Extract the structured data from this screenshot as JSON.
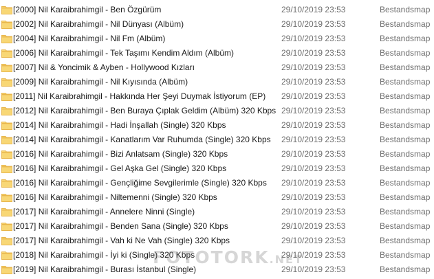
{
  "folders": [
    {
      "name": "[2000] Nil Karaibrahimgil - Ben Özgürüm",
      "date": "29/10/2019 23:53",
      "type": "Bestandsmap"
    },
    {
      "name": "[2002] Nil Karaibrahimgil - Nil Dünyası (Albüm)",
      "date": "29/10/2019 23:53",
      "type": "Bestandsmap"
    },
    {
      "name": "[2004] Nil Karaibrahimgil - Nil Fm (Albüm)",
      "date": "29/10/2019 23:53",
      "type": "Bestandsmap"
    },
    {
      "name": "[2006] Nil Karaibrahimgil - Tek Taşımı Kendim Aldım (Albüm)",
      "date": "29/10/2019 23:53",
      "type": "Bestandsmap"
    },
    {
      "name": "[2007] Nil & Yoncimik & Ayben - Hollywood Kızları",
      "date": "29/10/2019 23:53",
      "type": "Bestandsmap"
    },
    {
      "name": "[2009] Nil Karaibrahimgil - Nil Kıyısında (Albüm)",
      "date": "29/10/2019 23:53",
      "type": "Bestandsmap"
    },
    {
      "name": "[2011] Nil Karaibrahimgil - Hakkında Her Şeyi Duymak İstiyorum (EP)",
      "date": "29/10/2019 23:53",
      "type": "Bestandsmap"
    },
    {
      "name": "[2012] Nil Karaibrahimgil - Ben Buraya Çıplak Geldim (Albüm) 320 Kbps",
      "date": "29/10/2019 23:53",
      "type": "Bestandsmap"
    },
    {
      "name": "[2014] Nil Karaibrahimgil - Hadi İnşallah (Single) 320 Kbps",
      "date": "29/10/2019 23:53",
      "type": "Bestandsmap"
    },
    {
      "name": "[2014] Nil Karaibrahimgil - Kanatlarım Var Ruhumda (Single) 320 Kbps",
      "date": "29/10/2019 23:53",
      "type": "Bestandsmap"
    },
    {
      "name": "[2016] Nil Karaibrahimgil - Bizi Anlatsam (Single) 320 Kbps",
      "date": "29/10/2019 23:53",
      "type": "Bestandsmap"
    },
    {
      "name": "[2016] Nil Karaibrahimgil - Gel Aşka Gel (Single) 320 Kbps",
      "date": "29/10/2019 23:53",
      "type": "Bestandsmap"
    },
    {
      "name": "[2016] Nil Karaibrahimgil - Gençliğime Sevgilerimle (Single) 320 Kbps",
      "date": "29/10/2019 23:53",
      "type": "Bestandsmap"
    },
    {
      "name": "[2016] Nil Karaibrahimgil - Niltemenni (Single) 320 Kbps",
      "date": "29/10/2019 23:53",
      "type": "Bestandsmap"
    },
    {
      "name": "[2017] Nil Karaibrahimgil - Annelere Ninni (Single)",
      "date": "29/10/2019 23:53",
      "type": "Bestandsmap"
    },
    {
      "name": "[2017] Nil Karaibrahimgil - Benden Sana (Single) 320 Kbps",
      "date": "29/10/2019 23:53",
      "type": "Bestandsmap"
    },
    {
      "name": "[2017] Nil Karaibrahimgil - Vah ki Ne Vah (Single) 320 Kbps",
      "date": "29/10/2019 23:53",
      "type": "Bestandsmap"
    },
    {
      "name": "[2018] Nil Karaibrahimgil - İyi ki (Single) 320 Kbps",
      "date": "29/10/2019 23:53",
      "type": "Bestandsmap"
    },
    {
      "name": "[2019] Nil Karaibrahimgil - Burası İstanbul (Single)",
      "date": "29/10/2019 23:53",
      "type": "Bestandsmap"
    }
  ],
  "icons": {
    "folder": "folder-icon"
  },
  "colors": {
    "folder_body": "#f8d775",
    "folder_tab": "#e8b64c",
    "secondary_text": "#6d6d6d"
  },
  "watermark": {
    "text_a": "FOTOTORK",
    "text_b": ".NET"
  }
}
